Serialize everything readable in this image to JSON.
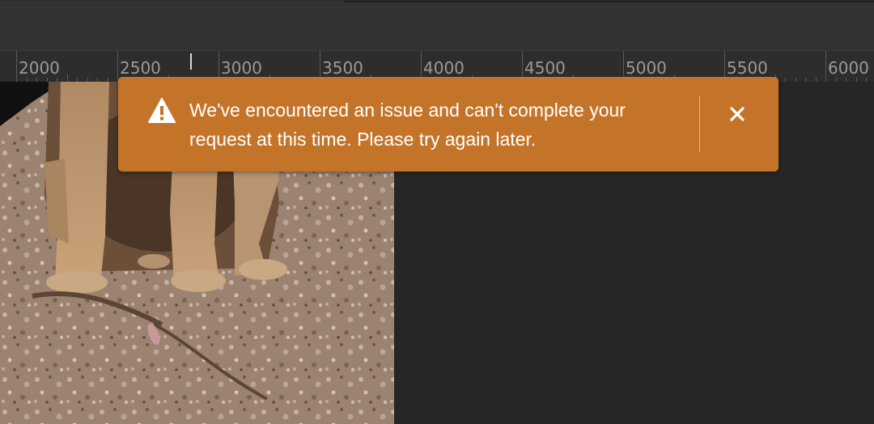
{
  "ruler": {
    "labels": [
      "2000",
      "2500",
      "3000",
      "3500",
      "4000",
      "4500",
      "5000",
      "5500",
      "6000"
    ]
  },
  "toast": {
    "type": "warning",
    "message": "We've encountered an issue and can't complete your request at this time. Please try again later.",
    "icon": "alert-triangle-icon",
    "close_icon": "close-icon",
    "background_color": "#c47429"
  },
  "colors": {
    "app_background": "#1e1e1e",
    "ruler_background": "#2d2d2d",
    "topbar_background": "#323232"
  }
}
